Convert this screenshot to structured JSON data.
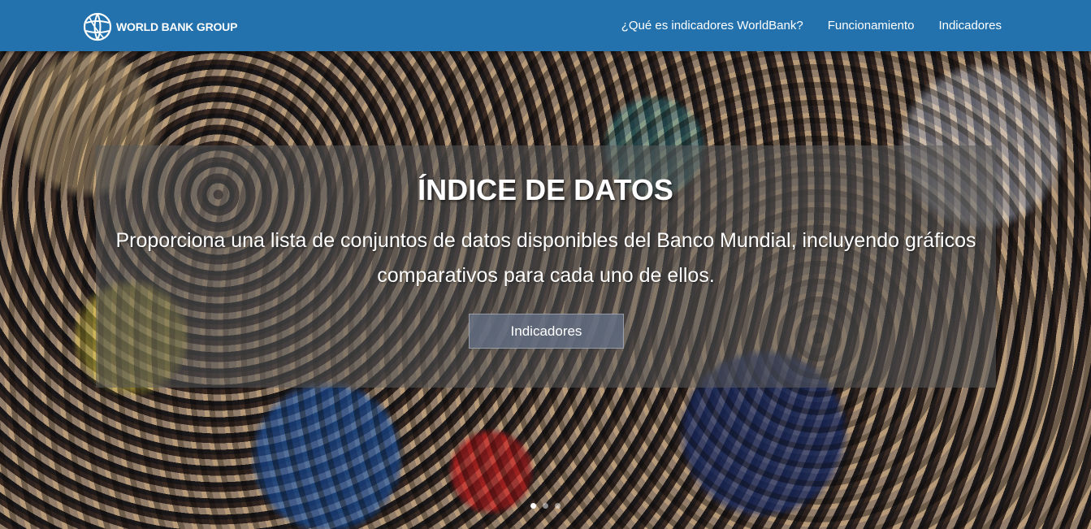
{
  "navbar": {
    "brand": "WORLD BANK GROUP",
    "links": [
      "¿Qué es indicadores WorldBank?",
      "Funcionamiento",
      "Indicadores"
    ]
  },
  "hero": {
    "title": "ÍNDICE DE DATOS",
    "subtitle": "Proporciona una lista de conjuntos de datos disponibles del Banco Mundial, incluyendo gráficos comparativos para cada uno de ellos.",
    "button_label": "Indicadores",
    "carousel_slides": 3,
    "active_slide": 1
  },
  "icons": {
    "logo": "globe-icon"
  },
  "colors": {
    "navbar": "#2472ad",
    "text": "#ffffff"
  }
}
